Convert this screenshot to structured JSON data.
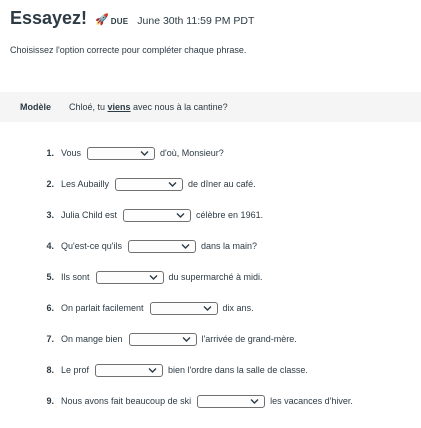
{
  "header": {
    "title": "Essayez!",
    "due_icon": "rocket-icon",
    "due_label": "DUE",
    "due_date": "June 30th 11:59 PM PDT"
  },
  "instructions": "Choisissez l'option correcte pour compléter chaque phrase.",
  "model": {
    "label": "Modèle",
    "before": "Chloé, tu ",
    "answer": "viens",
    "after": " avec nous à la cantine?"
  },
  "questions": [
    {
      "num": "1.",
      "before": "Vous",
      "after": "d'où, Monsieur?",
      "selected": ""
    },
    {
      "num": "2.",
      "before": "Les Aubailly",
      "after": "de dîner au café.",
      "selected": ""
    },
    {
      "num": "3.",
      "before": "Julia Child est",
      "after": "célèbre en 1961.",
      "selected": ""
    },
    {
      "num": "4.",
      "before": "Qu'est-ce qu'ils",
      "after": "dans la main?",
      "selected": ""
    },
    {
      "num": "5.",
      "before": "Ils sont",
      "after": "du supermarché à midi.",
      "selected": ""
    },
    {
      "num": "6.",
      "before": "On parlait facilement",
      "after": "dix ans.",
      "selected": ""
    },
    {
      "num": "7.",
      "before": "On mange bien",
      "after": "l'arrivée de grand-mère.",
      "selected": ""
    },
    {
      "num": "8.",
      "before": "Le prof",
      "after": "bien l'ordre dans la salle de classe.",
      "selected": ""
    },
    {
      "num": "9.",
      "before": "Nous avons fait beaucoup de ski",
      "after": "les vacances d'hiver.",
      "selected": ""
    }
  ]
}
